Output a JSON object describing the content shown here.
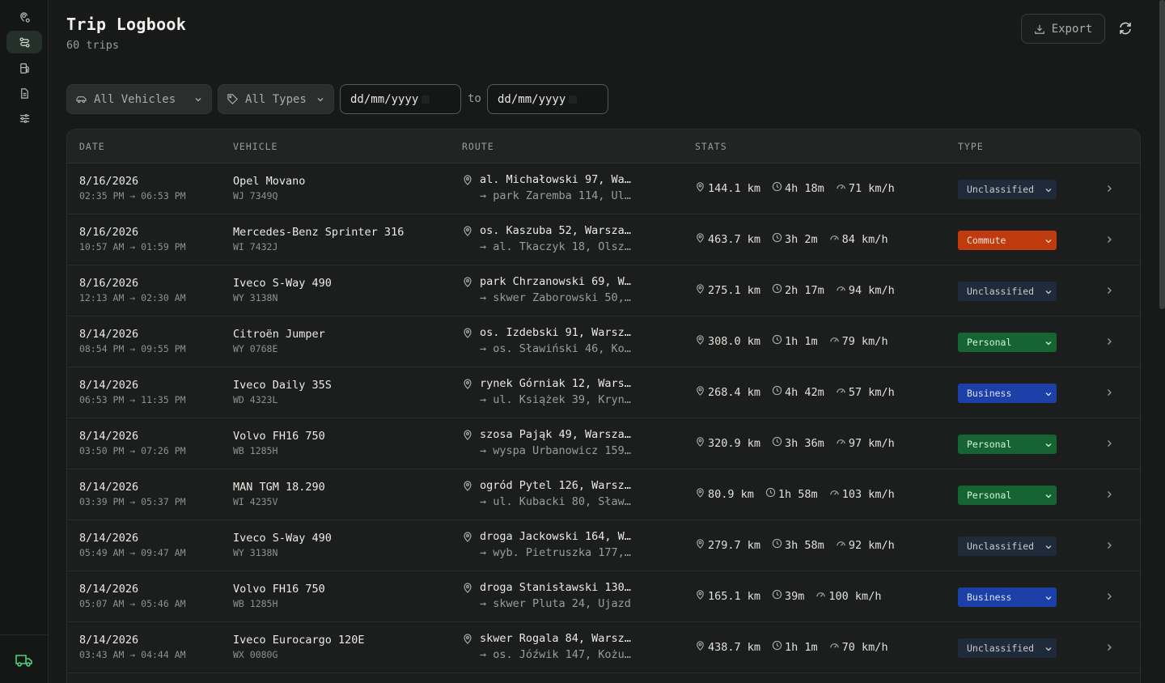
{
  "header": {
    "title": "Trip Logbook",
    "subtitle": "60 trips",
    "export_label": "Export"
  },
  "filters": {
    "vehicles_label": "All Vehicles",
    "types_label": "All Types",
    "date_from": "dd/mm/yyyy",
    "to_label": "to",
    "date_to": "dd/mm/yyyy"
  },
  "table": {
    "columns": [
      "DATE",
      "VEHICLE",
      "ROUTE",
      "STATS",
      "TYPE"
    ],
    "rows": [
      {
        "date": "8/16/2026",
        "time": "02:35 PM → 06:53 PM",
        "vehicle": "Opel Movano",
        "plate": "WJ 7349Q",
        "from": "al. Michałowski 97, Wa…",
        "to": "→ park Zaremba 114, Ul…",
        "distance": "144.1 km",
        "duration": "4h 18m",
        "speed": "71 km/h",
        "type": "Unclassified"
      },
      {
        "date": "8/16/2026",
        "time": "10:57 AM → 01:59 PM",
        "vehicle": "Mercedes-Benz Sprinter 316",
        "plate": "WI 7432J",
        "from": "os. Kaszuba 52, Warsza…",
        "to": "→ al. Tkaczyk 18, Olsz…",
        "distance": "463.7 km",
        "duration": "3h 2m",
        "speed": "84 km/h",
        "type": "Commute"
      },
      {
        "date": "8/16/2026",
        "time": "12:13 AM → 02:30 AM",
        "vehicle": "Iveco S-Way 490",
        "plate": "WY 3138N",
        "from": "park Chrzanowski 69, W…",
        "to": "→ skwer Zaborowski 50,…",
        "distance": "275.1 km",
        "duration": "2h 17m",
        "speed": "94 km/h",
        "type": "Unclassified"
      },
      {
        "date": "8/14/2026",
        "time": "08:54 PM → 09:55 PM",
        "vehicle": "Citroën Jumper",
        "plate": "WY 0768E",
        "from": "os. Izdebski 91, Warsz…",
        "to": "→ os. Sławiński 46, Ko…",
        "distance": "308.0 km",
        "duration": "1h 1m",
        "speed": "79 km/h",
        "type": "Personal"
      },
      {
        "date": "8/14/2026",
        "time": "06:53 PM → 11:35 PM",
        "vehicle": "Iveco Daily 35S",
        "plate": "WD 4323L",
        "from": "rynek Górniak 12, Wars…",
        "to": "→ ul. Książek 39, Kryn…",
        "distance": "268.4 km",
        "duration": "4h 42m",
        "speed": "57 km/h",
        "type": "Business"
      },
      {
        "date": "8/14/2026",
        "time": "03:50 PM → 07:26 PM",
        "vehicle": "Volvo FH16 750",
        "plate": "WB 1285H",
        "from": "szosa Pająk 49, Warsza…",
        "to": "→ wyspa Urbanowicz 159…",
        "distance": "320.9 km",
        "duration": "3h 36m",
        "speed": "97 km/h",
        "type": "Personal"
      },
      {
        "date": "8/14/2026",
        "time": "03:39 PM → 05:37 PM",
        "vehicle": "MAN TGM 18.290",
        "plate": "WI 4235V",
        "from": "ogród Pytel 126, Warsz…",
        "to": "→ ul. Kubacki 80, Sław…",
        "distance": "80.9 km",
        "duration": "1h 58m",
        "speed": "103 km/h",
        "type": "Personal"
      },
      {
        "date": "8/14/2026",
        "time": "05:49 AM → 09:47 AM",
        "vehicle": "Iveco S-Way 490",
        "plate": "WY 3138N",
        "from": "droga Jackowski 164, W…",
        "to": "→ wyb. Pietruszka 177,…",
        "distance": "279.7 km",
        "duration": "3h 58m",
        "speed": "92 km/h",
        "type": "Unclassified"
      },
      {
        "date": "8/14/2026",
        "time": "05:07 AM → 05:46 AM",
        "vehicle": "Volvo FH16 750",
        "plate": "WB 1285H",
        "from": "droga Stanisławski 130…",
        "to": "→ skwer Pluta 24, Ujazd",
        "distance": "165.1 km",
        "duration": "39m",
        "speed": "100 km/h",
        "type": "Business"
      },
      {
        "date": "8/14/2026",
        "time": "03:43 AM → 04:44 AM",
        "vehicle": "Iveco Eurocargo 120E",
        "plate": "WX 0080G",
        "from": "skwer Rogala 84, Warsz…",
        "to": "→ os. Jóźwik 147, Kożu…",
        "distance": "438.7 km",
        "duration": "1h 1m",
        "speed": "70 km/h",
        "type": "Unclassified"
      }
    ]
  },
  "icons": {
    "sidebar": [
      "map-pin-route-icon",
      "route-icon",
      "fuel-icon",
      "document-icon",
      "sliders-icon"
    ],
    "brand": "truck-icon"
  },
  "colors": {
    "unclassified": "#1f2b3b",
    "commute": "#bf3a0c",
    "personal": "#176433",
    "business": "#1c3fa8",
    "accent": "#4fcf7b"
  }
}
